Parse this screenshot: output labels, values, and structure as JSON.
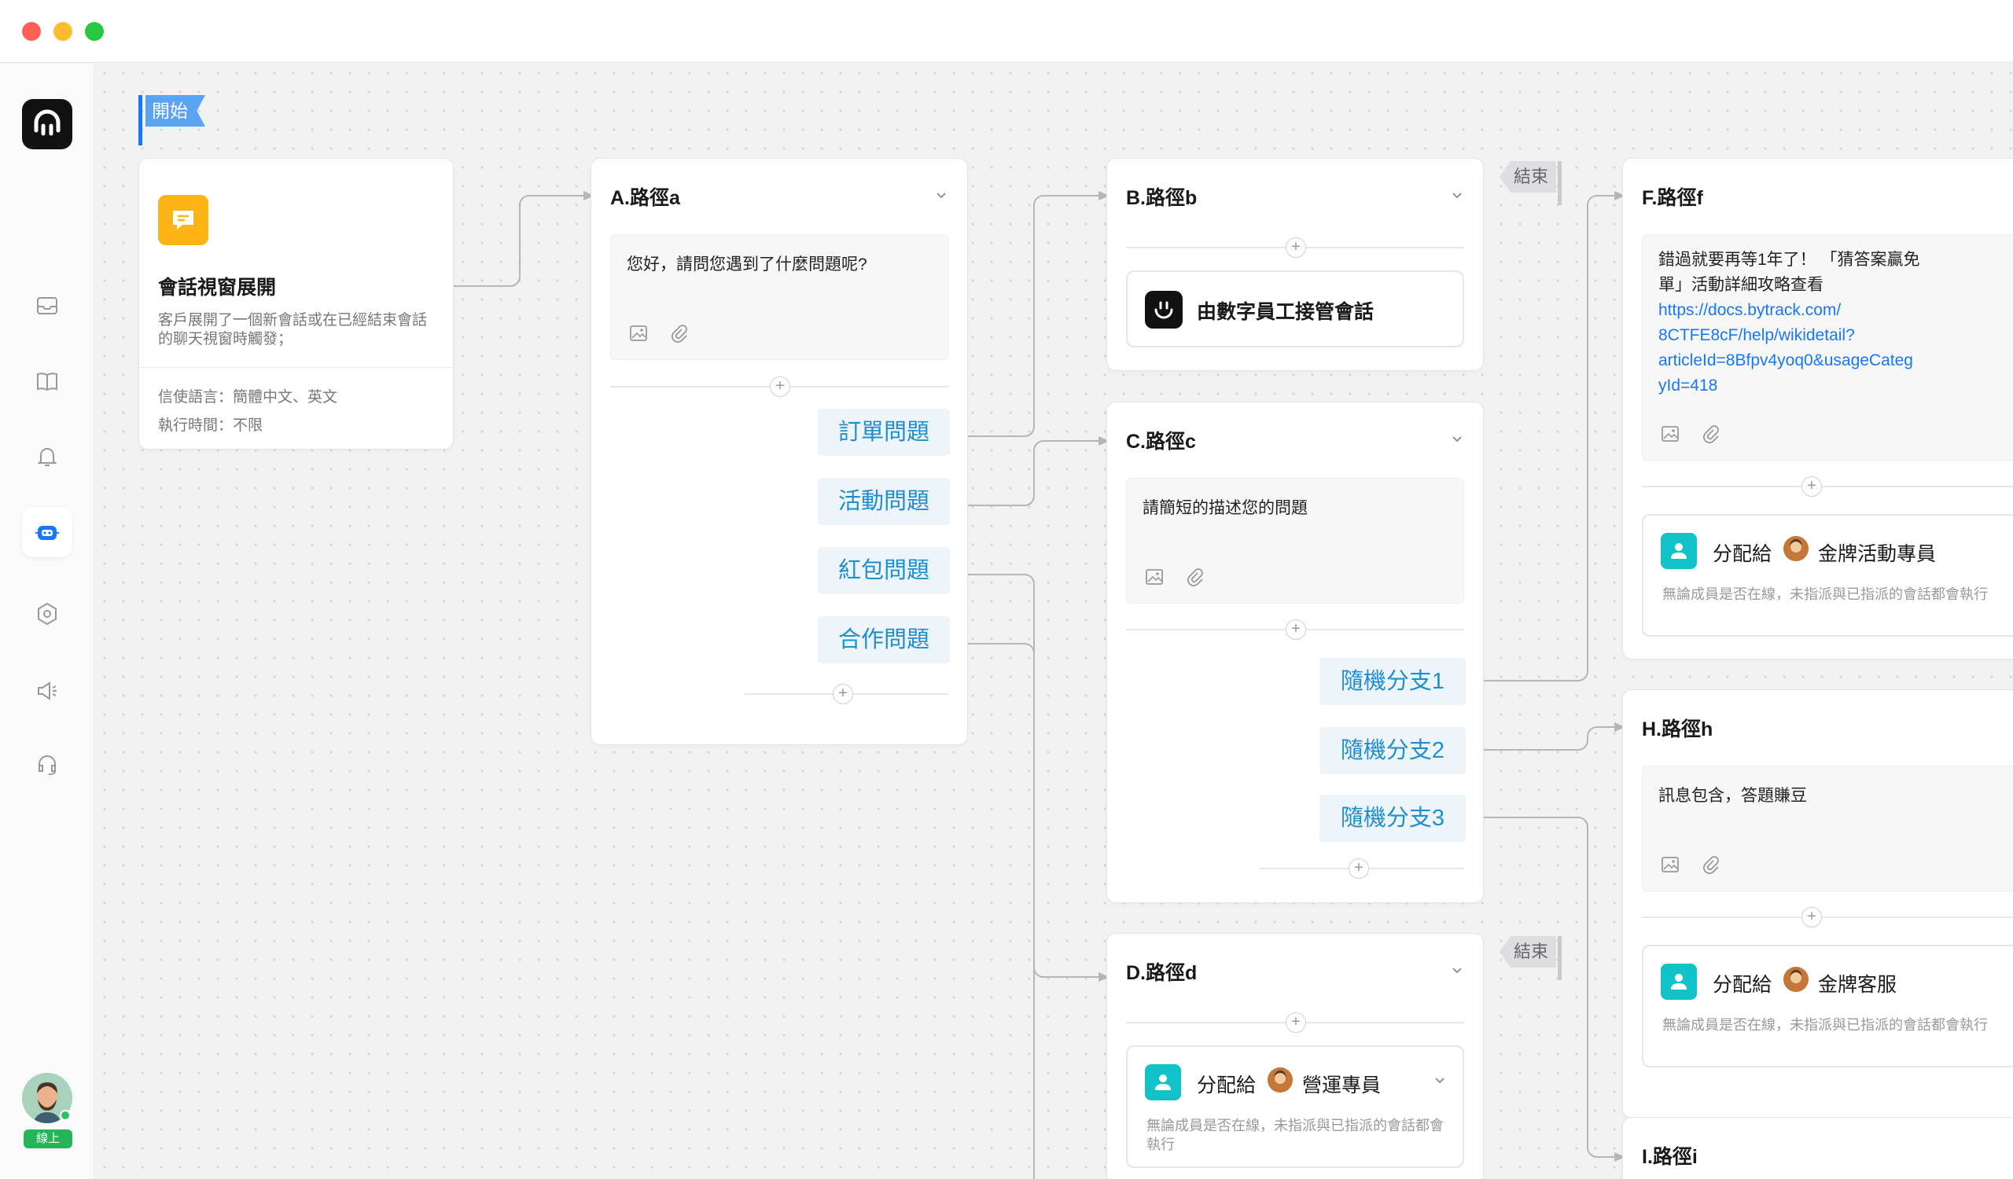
{
  "window": {
    "close_color": "#ff5f57",
    "min_color": "#febc2e",
    "max_color": "#28c840"
  },
  "sidebar": {
    "items": [
      "inbox-icon",
      "book-icon",
      "bell-icon",
      "bot-icon",
      "hexagon-settings-icon",
      "megaphone-icon",
      "headset-icon"
    ],
    "status_label": "線上",
    "accent": "#1677ff"
  },
  "start": {
    "tag": "開始",
    "title": "會話視窗展開",
    "desc": "客戶展開了一個新會話或在已經結束會話的聊天視窗時觸發；",
    "lang_label": "信使語言：",
    "lang_value": "簡體中文、英文",
    "time_label": "執行時間：",
    "time_value": "不限"
  },
  "nodeA": {
    "title": "A.路徑a",
    "message": "您好，請問您遇到了什麼問題呢?",
    "branches": [
      "訂單問題",
      "活動問題",
      "紅包問題",
      "合作問題"
    ]
  },
  "nodeB": {
    "title": "B.路徑b",
    "action": "由數字員工接管會話",
    "end_tag": "結束"
  },
  "nodeC": {
    "title": "C.路徑c",
    "message": "請簡短的描述您的問題",
    "branches": [
      "隨機分支1",
      "隨機分支2",
      "隨機分支3"
    ]
  },
  "nodeD": {
    "title": "D.路徑d",
    "end_tag": "結束",
    "assign_label": "分配給",
    "assignee": "營運專員",
    "assign_desc": "無論成員是否在線，未指派與已指派的會話都會執行"
  },
  "nodeF": {
    "title": "F.路徑f",
    "message_line1": "錯過就要再等1年了！ 「猜答案贏免",
    "message_line2": "單」活動詳細攻略查看",
    "link_lines": [
      "https://docs.bytrack.com/",
      "8CTFE8cF/help/wikidetail?",
      "articleId=8Bfpv4yoq0&usageCateg",
      "yId=418"
    ],
    "assign_label": "分配給",
    "assignee": "金牌活動專員",
    "assign_desc": "無論成員是否在線，未指派與已指派的會話都會執行"
  },
  "nodeH": {
    "title": "H.路徑h",
    "message": "訊息包含，答題賺豆",
    "assign_label": "分配給",
    "assignee": "金牌客服",
    "assign_desc": "無論成員是否在線，未指派與已指派的會話都會執行"
  },
  "nodeI": {
    "title": "I.路徑i"
  }
}
